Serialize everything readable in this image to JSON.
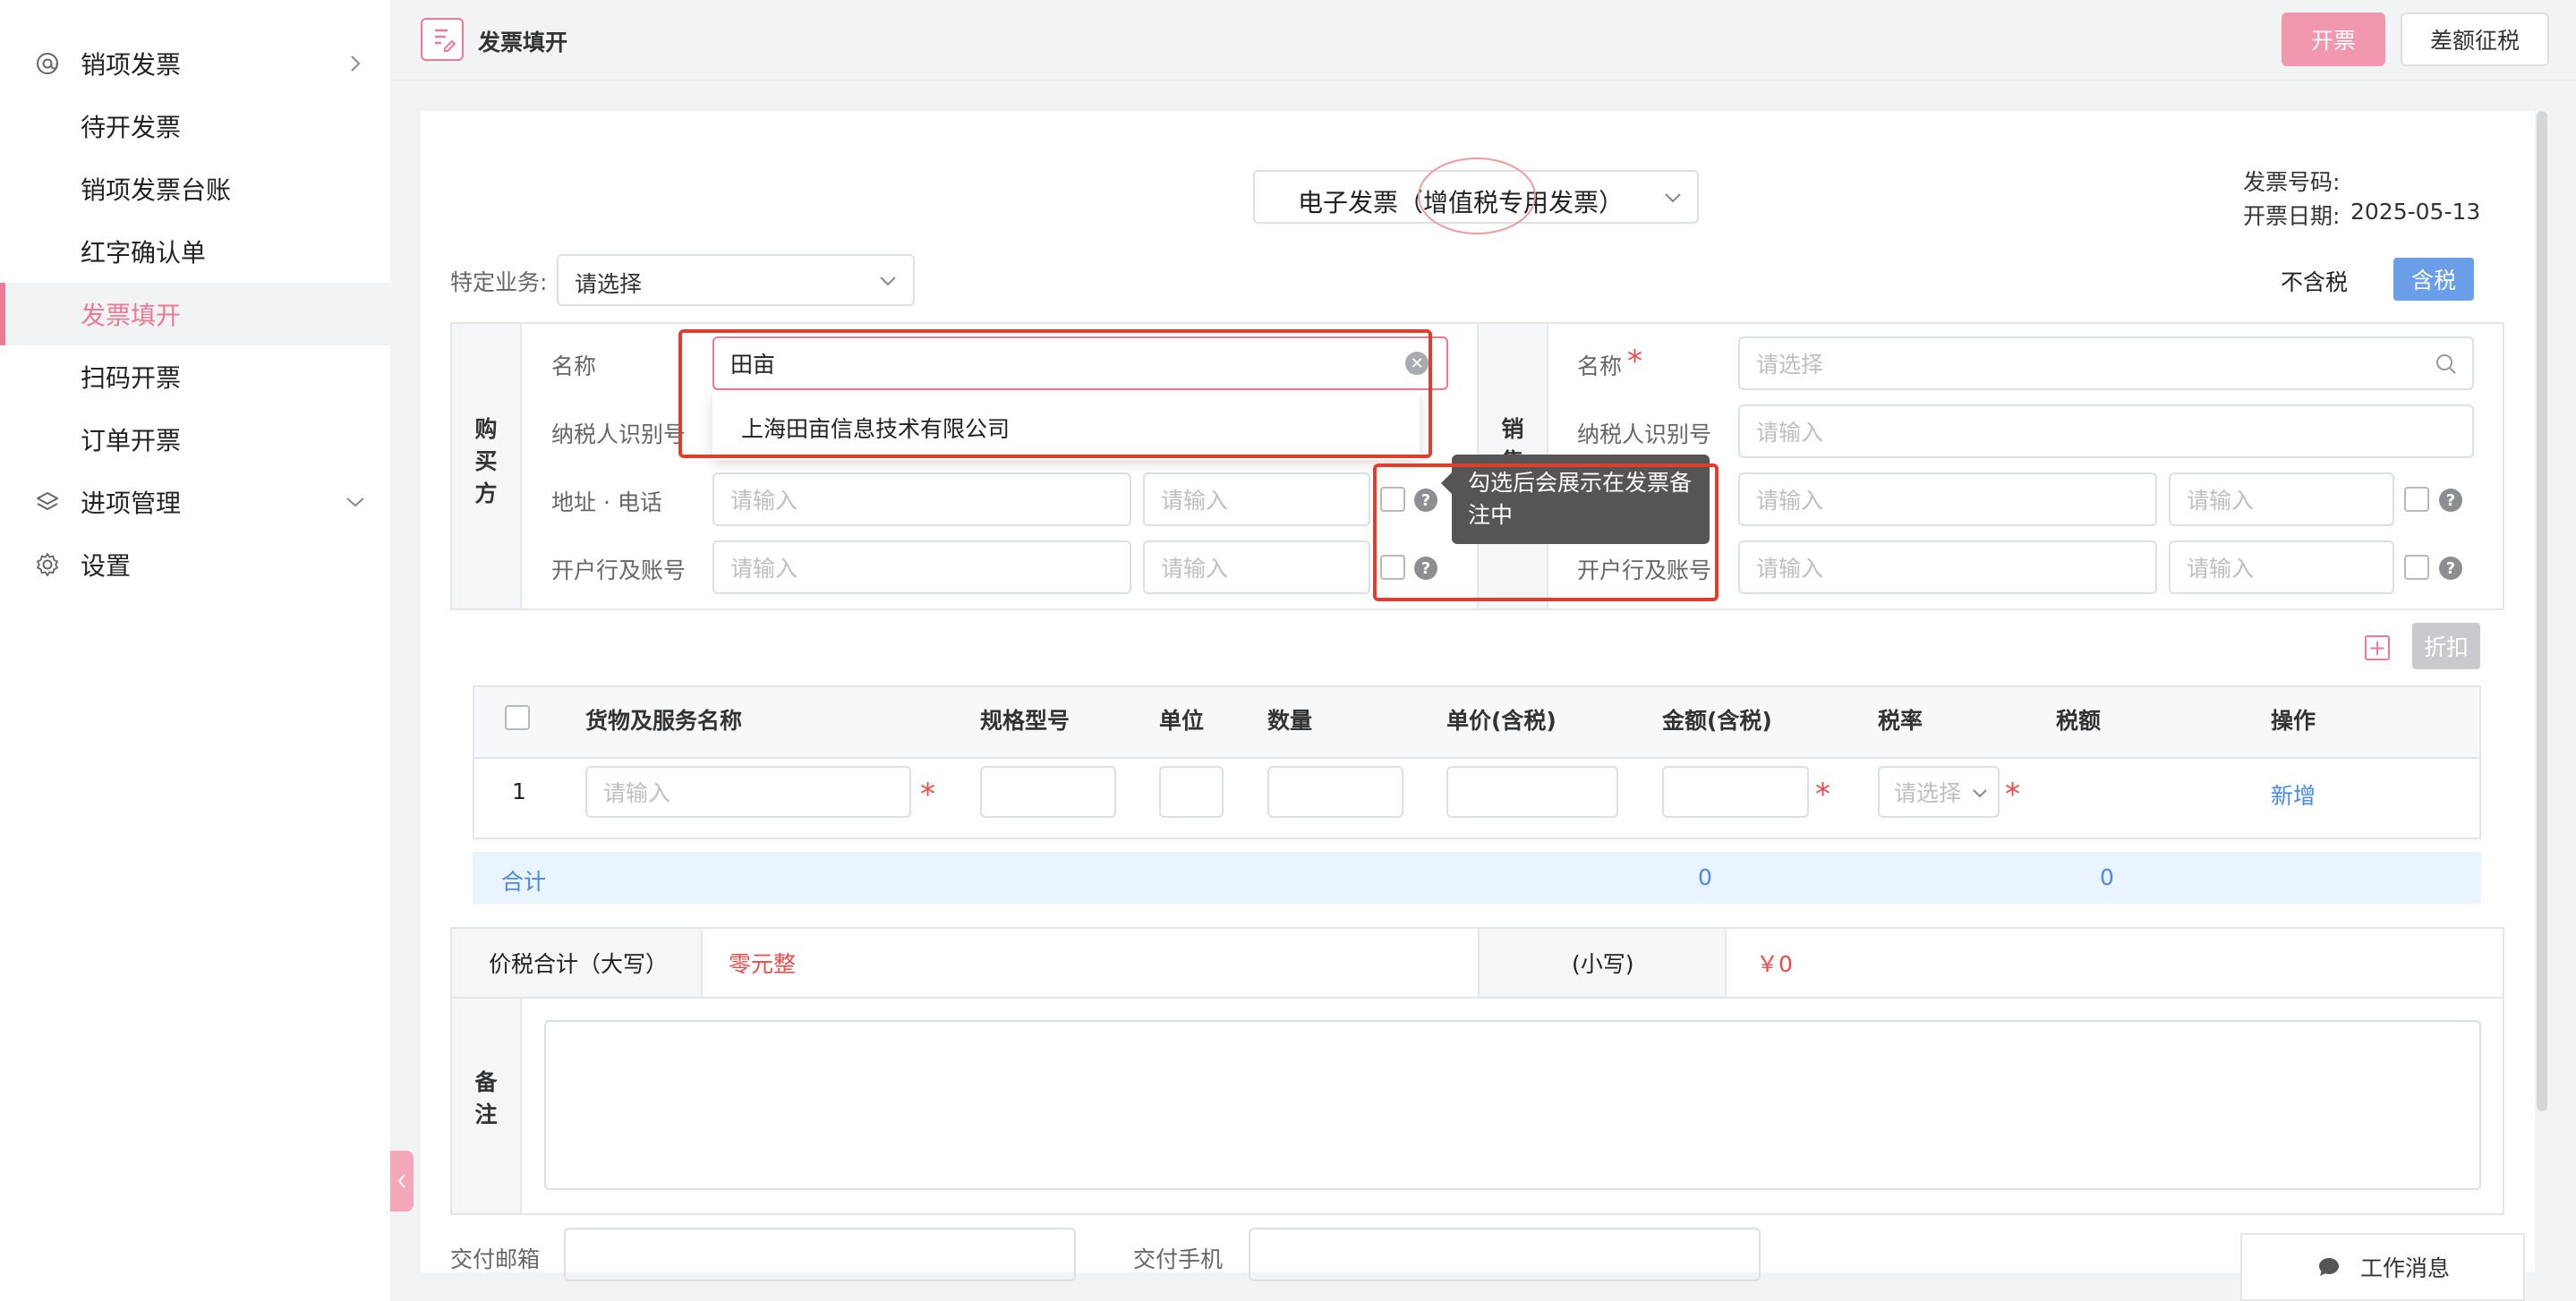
{
  "sidebar": {
    "items": [
      {
        "label": "销项发票",
        "type": "group",
        "icon": "at-icon",
        "expanded": false
      },
      {
        "label": "待开发票",
        "type": "sub"
      },
      {
        "label": "销项发票台账",
        "type": "sub"
      },
      {
        "label": "红字确认单",
        "type": "sub"
      },
      {
        "label": "发票填开",
        "type": "sub",
        "active": true
      },
      {
        "label": "扫码开票",
        "type": "sub"
      },
      {
        "label": "订单开票",
        "type": "sub"
      },
      {
        "label": "进项管理",
        "type": "group",
        "icon": "layers-icon",
        "expanded": true
      },
      {
        "label": "设置",
        "type": "group",
        "icon": "gear-icon"
      }
    ]
  },
  "header": {
    "title": "发票填开",
    "issue_button": "开票",
    "diff_tax_button": "差额征税"
  },
  "invoice": {
    "type_select": "电子发票（增值税专用发票）",
    "number_label": "发票号码:",
    "date_label": "开票日期:",
    "date_value": "2025-05-13",
    "special_business_label": "特定业务:",
    "special_business_value": "请选择",
    "tax_excluded": "不含税",
    "tax_included": "含税"
  },
  "buyer": {
    "side_label": "购买方",
    "name_label": "名称",
    "name_value": "田亩",
    "taxid_label": "纳税人识别号",
    "address_label": "地址 · 电话",
    "bank_label": "开户行及账号",
    "input_placeholder": "请输入",
    "suggestion": "上海田亩信息技术有限公司",
    "tooltip": "勾选后会展示在发票备注中"
  },
  "seller": {
    "side_label": "销售方",
    "name_label": "名称",
    "name_placeholder": "请选择",
    "taxid_label": "纳税人识别号",
    "bank_label": "开户行及账号",
    "input_placeholder": "请输入"
  },
  "items_table": {
    "discount_button": "折扣",
    "headers": [
      "货物及服务名称",
      "规格型号",
      "单位",
      "数量",
      "单价(含税)",
      "金额(含税)",
      "税率",
      "税额",
      "操作"
    ],
    "row": {
      "index": "1",
      "name_placeholder": "请输入",
      "rate_placeholder": "请选择",
      "action": "新增"
    },
    "total": {
      "label": "合计",
      "amount": "0",
      "tax": "0"
    }
  },
  "price_total": {
    "capital_label": "价税合计（大写）",
    "capital_value": "零元整",
    "small_label": "(小写)",
    "small_value": "￥0"
  },
  "remark": {
    "label": "备注"
  },
  "delivery": {
    "email_label": "交付邮箱",
    "phone_label": "交付手机"
  },
  "chat": {
    "label": "工作消息"
  },
  "colors": {
    "accent": "#ea7a96",
    "primary_button": "#f198ae",
    "link": "#4a8ae6",
    "warning": "#e84b4b",
    "annotation": "#e23c2c"
  }
}
